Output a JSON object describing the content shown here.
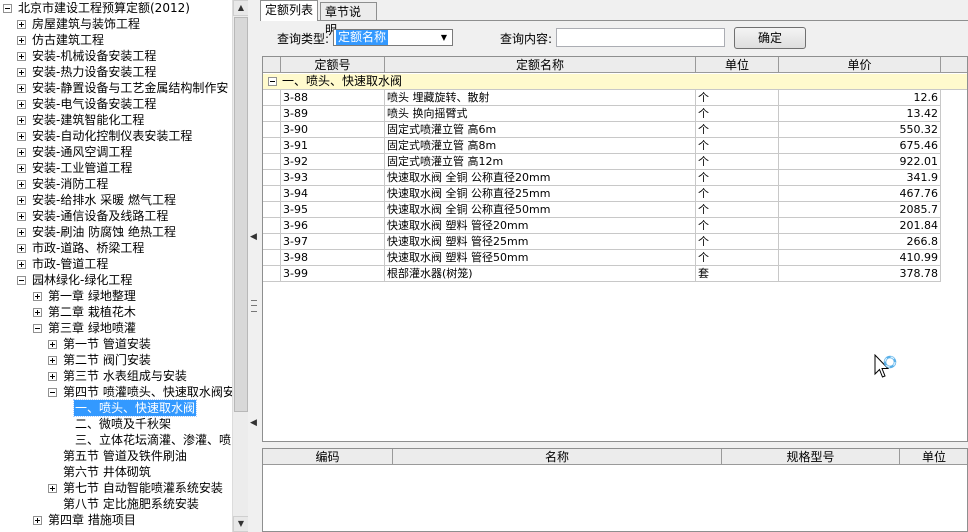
{
  "tree": {
    "root_label": "北京市建设工程预算定额(2012)",
    "items": [
      {
        "label": "房屋建筑与装饰工程",
        "level": 1,
        "state": "plus"
      },
      {
        "label": "仿古建筑工程",
        "level": 1,
        "state": "plus"
      },
      {
        "label": "安装-机械设备安装工程",
        "level": 1,
        "state": "plus"
      },
      {
        "label": "安装-热力设备安装工程",
        "level": 1,
        "state": "plus"
      },
      {
        "label": "安装-静置设备与工艺金属结构制作安",
        "level": 1,
        "state": "plus"
      },
      {
        "label": "安装-电气设备安装工程",
        "level": 1,
        "state": "plus"
      },
      {
        "label": "安装-建筑智能化工程",
        "level": 1,
        "state": "plus"
      },
      {
        "label": "安装-自动化控制仪表安装工程",
        "level": 1,
        "state": "plus"
      },
      {
        "label": "安装-通风空调工程",
        "level": 1,
        "state": "plus"
      },
      {
        "label": "安装-工业管道工程",
        "level": 1,
        "state": "plus"
      },
      {
        "label": "安装-消防工程",
        "level": 1,
        "state": "plus"
      },
      {
        "label": "安装-给排水 采暖 燃气工程",
        "level": 1,
        "state": "plus"
      },
      {
        "label": "安装-通信设备及线路工程",
        "level": 1,
        "state": "plus"
      },
      {
        "label": "安装-刷油 防腐蚀 绝热工程",
        "level": 1,
        "state": "plus"
      },
      {
        "label": "市政-道路、桥梁工程",
        "level": 1,
        "state": "plus"
      },
      {
        "label": "市政-管道工程",
        "level": 1,
        "state": "plus"
      },
      {
        "label": "园林绿化-绿化工程",
        "level": 1,
        "state": "minus"
      },
      {
        "label": "第一章 绿地整理",
        "level": 2,
        "state": "plus"
      },
      {
        "label": "第二章 栽植花木",
        "level": 2,
        "state": "plus"
      },
      {
        "label": "第三章 绿地喷灌",
        "level": 2,
        "state": "minus"
      },
      {
        "label": "第一节 管道安装",
        "level": 3,
        "state": "plus"
      },
      {
        "label": "第二节 阀门安装",
        "level": 3,
        "state": "plus"
      },
      {
        "label": "第三节 水表组成与安装",
        "level": 3,
        "state": "plus"
      },
      {
        "label": "第四节 喷灌喷头、快速取水阀安",
        "level": 3,
        "state": "minus"
      },
      {
        "label": "一、喷头、快速取水阀",
        "level": 4,
        "state": "none",
        "selected": true
      },
      {
        "label": "二、微喷及千秋架",
        "level": 4,
        "state": "none"
      },
      {
        "label": "三、立体花坛滴灌、渗灌、喷",
        "level": 4,
        "state": "none"
      },
      {
        "label": "第五节 管道及铁件刷油",
        "level": 3,
        "state": "none"
      },
      {
        "label": "第六节 井体砌筑",
        "level": 3,
        "state": "none"
      },
      {
        "label": "第七节 自动智能喷灌系统安装",
        "level": 3,
        "state": "plus"
      },
      {
        "label": "第八节 定比施肥系统安装",
        "level": 3,
        "state": "none"
      },
      {
        "label": "第四章 措施项目",
        "level": 2,
        "state": "plus"
      }
    ]
  },
  "tabs": [
    {
      "label": "定额列表",
      "active": true
    },
    {
      "label": "章节说明",
      "active": false
    }
  ],
  "query": {
    "type_label": "查询类型:",
    "type_value": "定额名称",
    "content_label": "查询内容:",
    "content_value": "",
    "confirm_label": "确定"
  },
  "grid": {
    "headers": [
      "定额号",
      "定额名称",
      "单位",
      "单价"
    ],
    "group_label": "一、喷头、快速取水阀",
    "rows": [
      {
        "code": "3-88",
        "name": "喷头 埋藏旋转、散射",
        "unit": "个",
        "price": "12.6"
      },
      {
        "code": "3-89",
        "name": "喷头 换向摇臂式",
        "unit": "个",
        "price": "13.42"
      },
      {
        "code": "3-90",
        "name": "固定式喷灌立管 高6m",
        "unit": "个",
        "price": "550.32"
      },
      {
        "code": "3-91",
        "name": "固定式喷灌立管 高8m",
        "unit": "个",
        "price": "675.46"
      },
      {
        "code": "3-92",
        "name": "固定式喷灌立管 高12m",
        "unit": "个",
        "price": "922.01"
      },
      {
        "code": "3-93",
        "name": "快速取水阀 全铜 公称直径20mm",
        "unit": "个",
        "price": "341.9"
      },
      {
        "code": "3-94",
        "name": "快速取水阀 全铜 公称直径25mm",
        "unit": "个",
        "price": "467.76"
      },
      {
        "code": "3-95",
        "name": "快速取水阀 全铜 公称直径50mm",
        "unit": "个",
        "price": "2085.7"
      },
      {
        "code": "3-96",
        "name": "快速取水阀 塑料 管径20mm",
        "unit": "个",
        "price": "201.84"
      },
      {
        "code": "3-97",
        "name": "快速取水阀 塑料 管径25mm",
        "unit": "个",
        "price": "266.8"
      },
      {
        "code": "3-98",
        "name": "快速取水阀 塑料 管径50mm",
        "unit": "个",
        "price": "410.99"
      },
      {
        "code": "3-99",
        "name": "根部灌水器(树笼)",
        "unit": "套",
        "price": "378.78"
      }
    ]
  },
  "detail_grid": {
    "headers": [
      "编码",
      "名称",
      "规格型号",
      "单位"
    ]
  },
  "icons": {
    "tree_expand": "plus-box-icon",
    "tree_collapse": "minus-box-icon",
    "dropdown": "chevron-down-icon",
    "cursor": "busy-cursor-icon"
  },
  "colors": {
    "selection": "#3399ff",
    "group_row": "#fffacd",
    "header": "#ececec"
  }
}
